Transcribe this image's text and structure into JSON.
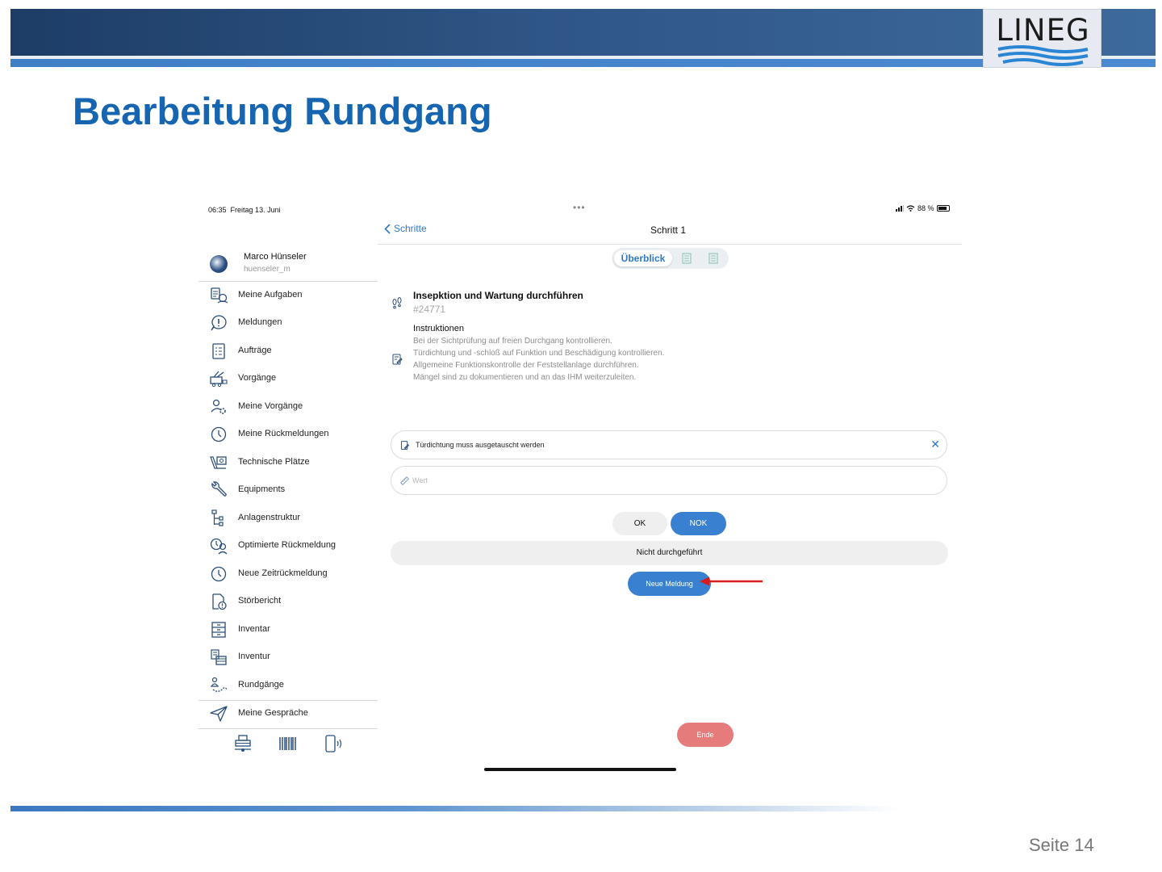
{
  "slide": {
    "title": "Bearbeitung Rundgang",
    "logo_text": "LINEG",
    "page_label": "Seite 14",
    "colors": {
      "title": "#1565b0",
      "header_dark": "#1d3d66",
      "header_stripe": "#3f7fc6"
    }
  },
  "status_bar": {
    "time": "06:35",
    "date": "Freitag 13. Juni",
    "dots": "•••",
    "battery": "88 %"
  },
  "profile": {
    "name": "Marco Hünseler",
    "username": "huenseler_m"
  },
  "sidebar": {
    "items": [
      {
        "label": "Meine Aufgaben",
        "icon": "tasks-icon"
      },
      {
        "label": "Meldungen",
        "icon": "notification-icon"
      },
      {
        "label": "Aufträge",
        "icon": "orders-icon"
      },
      {
        "label": "Vorgänge",
        "icon": "processes-icon"
      },
      {
        "label": "Meine Vorgänge",
        "icon": "my-processes-icon"
      },
      {
        "label": "Meine Rückmeldungen",
        "icon": "clock-icon"
      },
      {
        "label": "Technische Plätze",
        "icon": "technical-places-icon"
      },
      {
        "label": "Equipments",
        "icon": "wrench-icon"
      },
      {
        "label": "Anlagenstruktur",
        "icon": "structure-icon"
      },
      {
        "label": "Optimierte Rückmeldung",
        "icon": "optimized-feedback-icon"
      },
      {
        "label": "Neue Zeitrückmeldung",
        "icon": "clock-icon"
      },
      {
        "label": "Störbericht",
        "icon": "fault-report-icon"
      },
      {
        "label": "Inventar",
        "icon": "inventory-icon"
      },
      {
        "label": "Inventur",
        "icon": "stocktaking-icon"
      },
      {
        "label": "Rundgänge",
        "icon": "rounds-icon"
      },
      {
        "label": "Meine Gespräche",
        "icon": "send-icon"
      }
    ],
    "bottom_icons": [
      "warehouse-icon",
      "barcode-icon",
      "nfc-phone-icon"
    ]
  },
  "nav": {
    "back_label": "Schritte",
    "title": "Schritt 1"
  },
  "segment": {
    "active_label": "Überblick",
    "other_icons": [
      "checklist-icon",
      "checklist-icon"
    ]
  },
  "task": {
    "title": "Insepktion und Wartung durchführen",
    "id": "#24771",
    "instructions_heading": "Instruktionen",
    "instructions": [
      "Bei der Sichtprüfung auf freien Durchgang kontrollieren.",
      "Türdichtung und -schloß auf Funktion und Beschädigung kontrollieren.",
      "Allgemeine Funktionskontrolle der Feststellanlage durchführen.",
      "Mängel sind zu dokumentieren und an das IHM weiterzuleiten."
    ]
  },
  "fields": {
    "note_value": "Türdichtung muss ausgetauscht werden",
    "clear_glyph": "✕",
    "value_placeholder": "Wert"
  },
  "buttons": {
    "ok": "OK",
    "nok": "NOK",
    "not_done": "Nicht durchgeführt",
    "new_report": "Neue Meldung",
    "end": "Ende"
  },
  "colors": {
    "accent": "#3a80d0",
    "end_button": "#e67b7b",
    "arrow": "#d41e1e"
  }
}
